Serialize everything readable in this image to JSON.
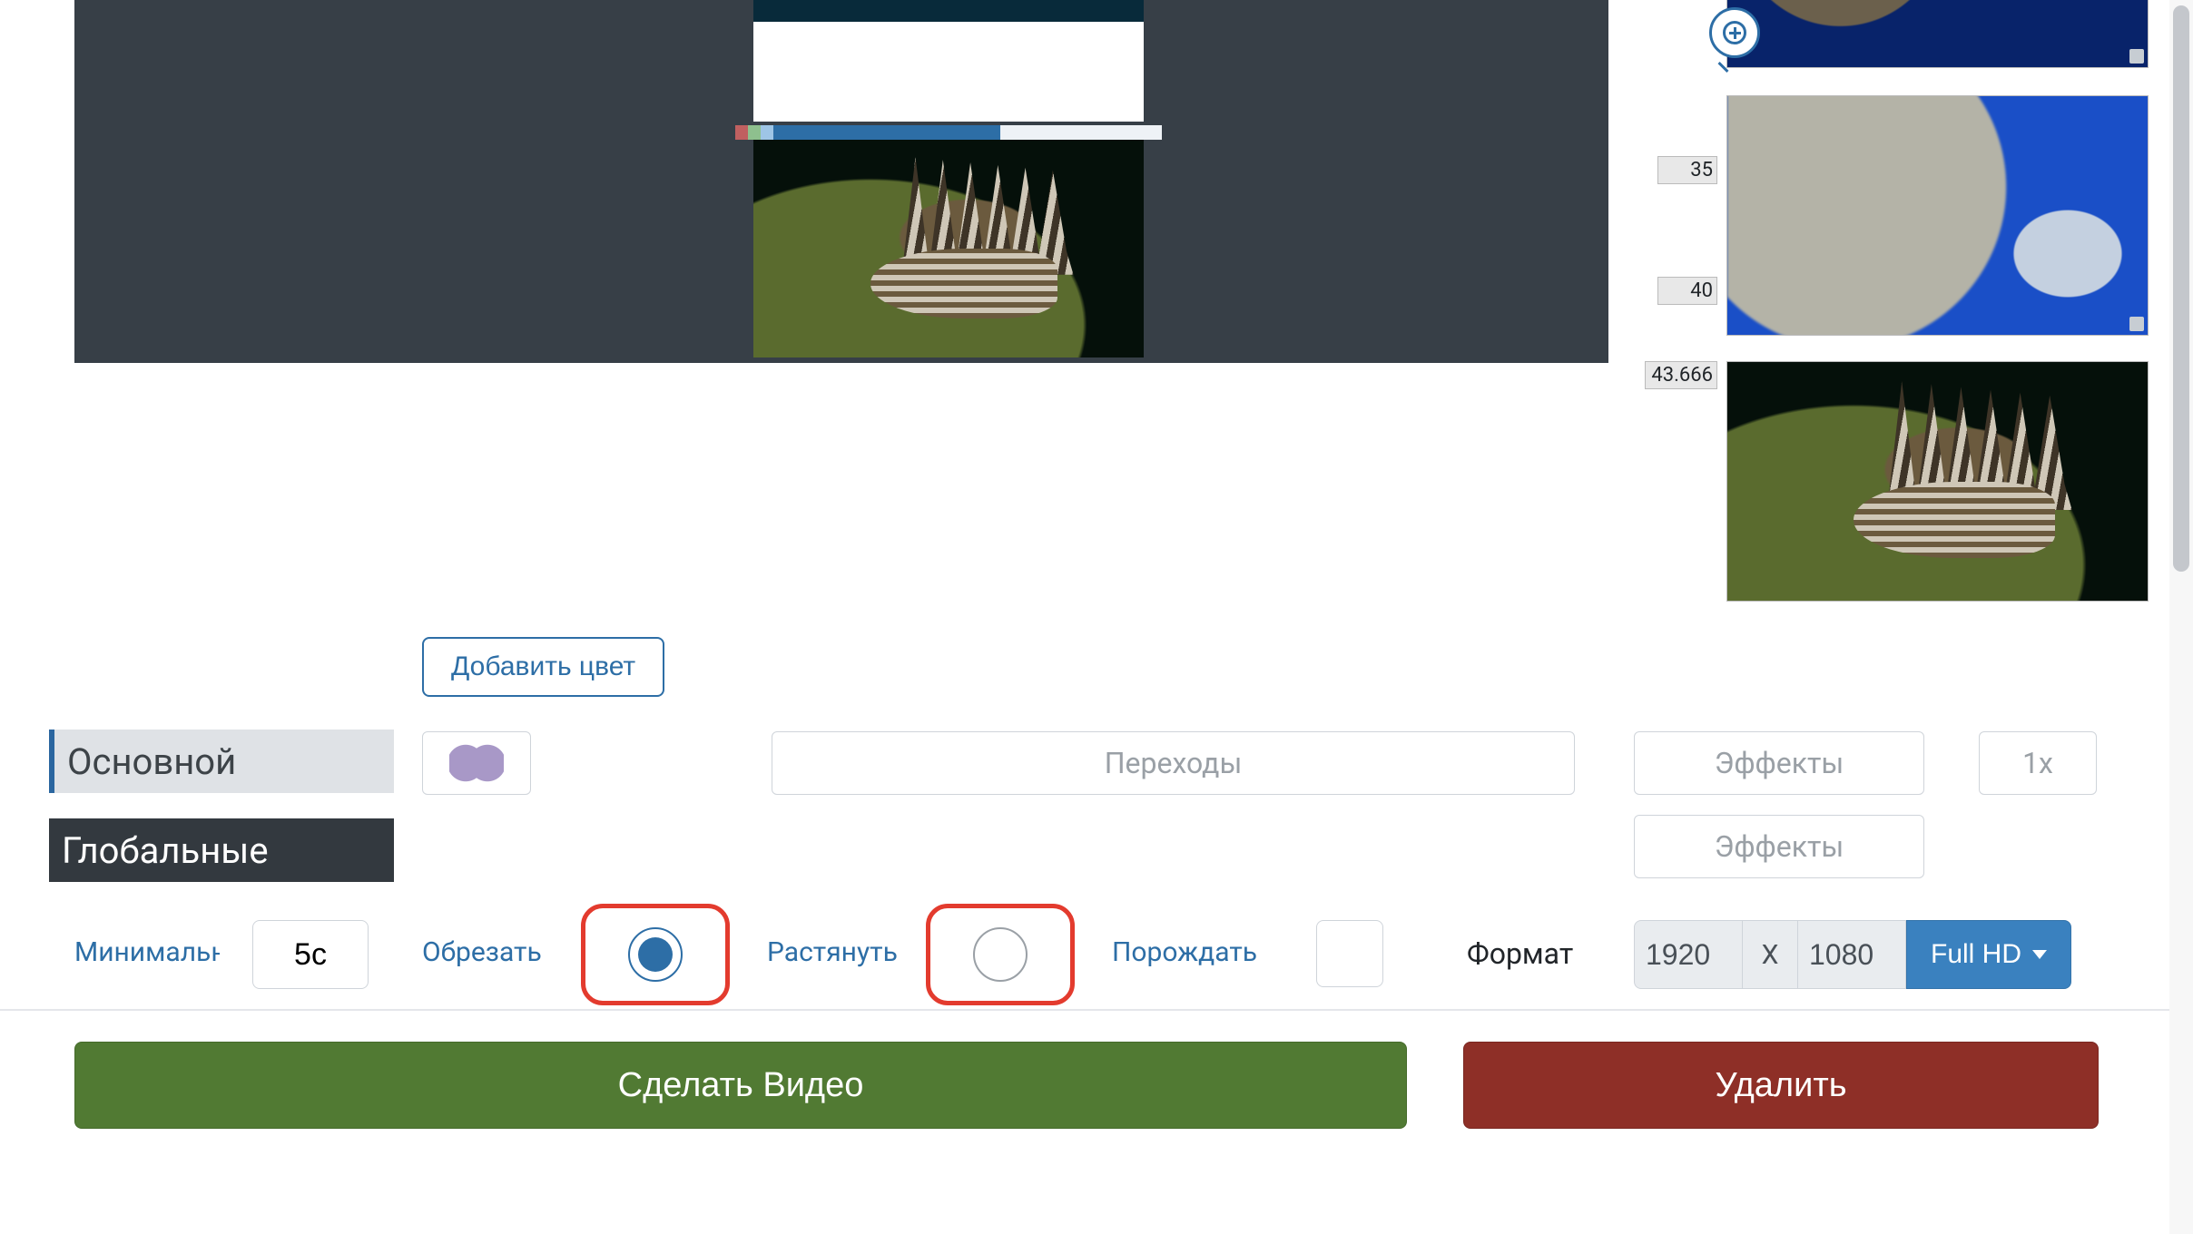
{
  "timeline": {
    "labels": {
      "t35": "35",
      "t40": "40",
      "t43": "43.666"
    }
  },
  "controls": {
    "add_color_label": "Добавить цвет",
    "tab_main": "Основной",
    "tab_global": "Глобальные",
    "transitions_placeholder": "Переходы",
    "effects_placeholder": "Эффекты",
    "speed_placeholder": "1x",
    "min_label": "Минимальн",
    "min_value": "5с",
    "crop_label": "Обрезать",
    "stretch_label": "Растянуть",
    "generate_label": "Порождать",
    "format_label": "Формат",
    "width_value": "1920",
    "x_label": "X",
    "height_value": "1080",
    "fullhd_label": "Full HD"
  },
  "footer": {
    "make_label": "Сделать Видео",
    "delete_label": "Удалить"
  }
}
